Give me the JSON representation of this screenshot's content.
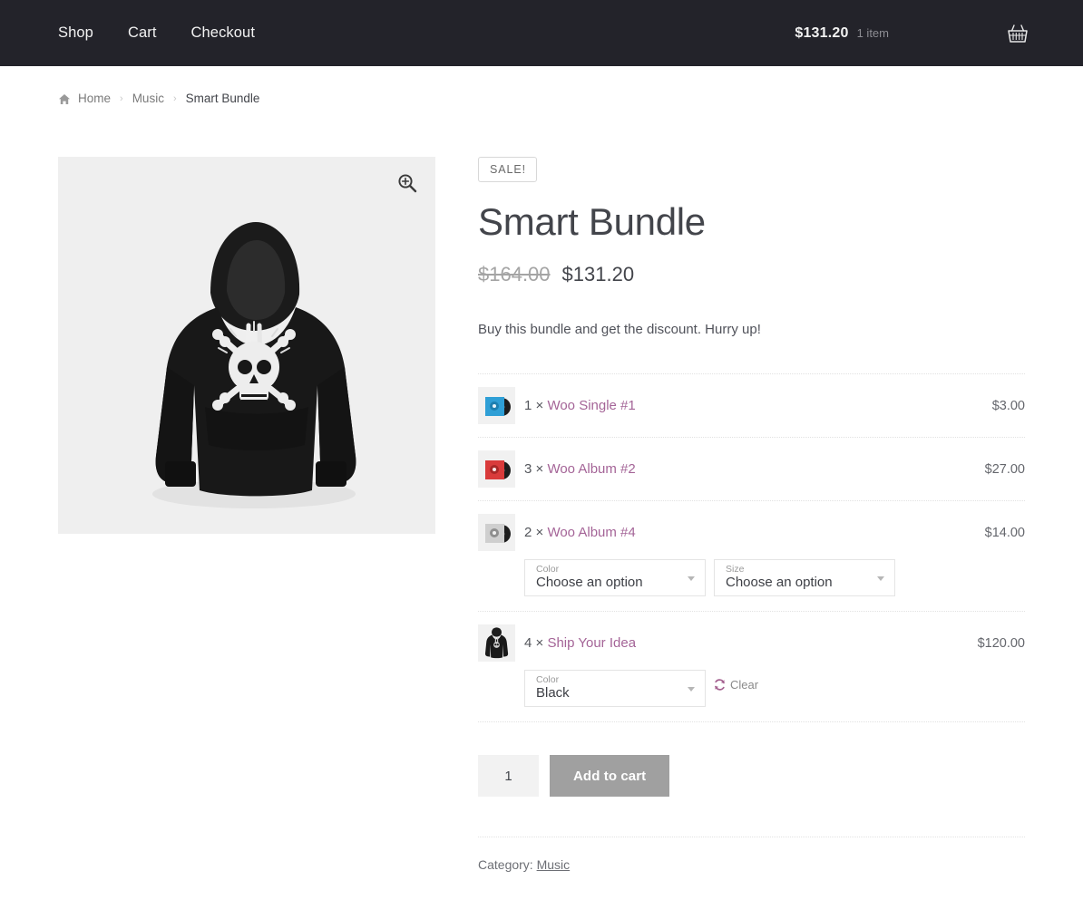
{
  "header": {
    "nav": [
      {
        "label": "Shop",
        "name": "nav-shop"
      },
      {
        "label": "Cart",
        "name": "nav-cart"
      },
      {
        "label": "Checkout",
        "name": "nav-checkout"
      }
    ],
    "cart": {
      "amount": "$131.20",
      "count": "1 item",
      "icon": "basket-icon"
    },
    "background_color": "#23232a"
  },
  "breadcrumb": {
    "home_icon": "home-icon",
    "items": [
      {
        "label": "Home",
        "current": false
      },
      {
        "label": "Music",
        "current": false
      },
      {
        "label": "Smart Bundle",
        "current": true
      }
    ],
    "separator": "›"
  },
  "gallery": {
    "zoom_icon": "magnifier-plus-icon",
    "image_alt": "Ship Your Idea black hoodie with skull and crossbones print",
    "background_color": "#efefef"
  },
  "product": {
    "sale_badge": "SALE!",
    "title": "Smart Bundle",
    "price_old": "$164.00",
    "price_new": "$131.20",
    "short_description": "Buy this bundle and get the discount. Hurry up!",
    "accent_color": "#a46497"
  },
  "bundle": {
    "items": [
      {
        "quantity_prefix": "1 ×",
        "name": "Woo Single #1",
        "price": "$3.00",
        "thumb": "album-blue",
        "variations": []
      },
      {
        "quantity_prefix": "3 ×",
        "name": "Woo Album #2",
        "price": "$27.00",
        "thumb": "album-red",
        "variations": []
      },
      {
        "quantity_prefix": "2 ×",
        "name": "Woo Album #4",
        "price": "$14.00",
        "thumb": "album-gray",
        "variations": [
          {
            "label": "Color",
            "value": "Choose an option"
          },
          {
            "label": "Size",
            "value": "Choose an option"
          }
        ],
        "clear": null
      },
      {
        "quantity_prefix": "4 ×",
        "name": "Ship Your Idea",
        "price": "$120.00",
        "thumb": "hoodie-black",
        "variations": [
          {
            "label": "Color",
            "value": "Black"
          }
        ],
        "clear": "Clear"
      }
    ]
  },
  "cart_form": {
    "quantity": "1",
    "add_to_cart_label": "Add to cart",
    "add_to_cart_color": "#a0a0a0"
  },
  "meta": {
    "category_label": "Category:",
    "category_value": "Music"
  }
}
